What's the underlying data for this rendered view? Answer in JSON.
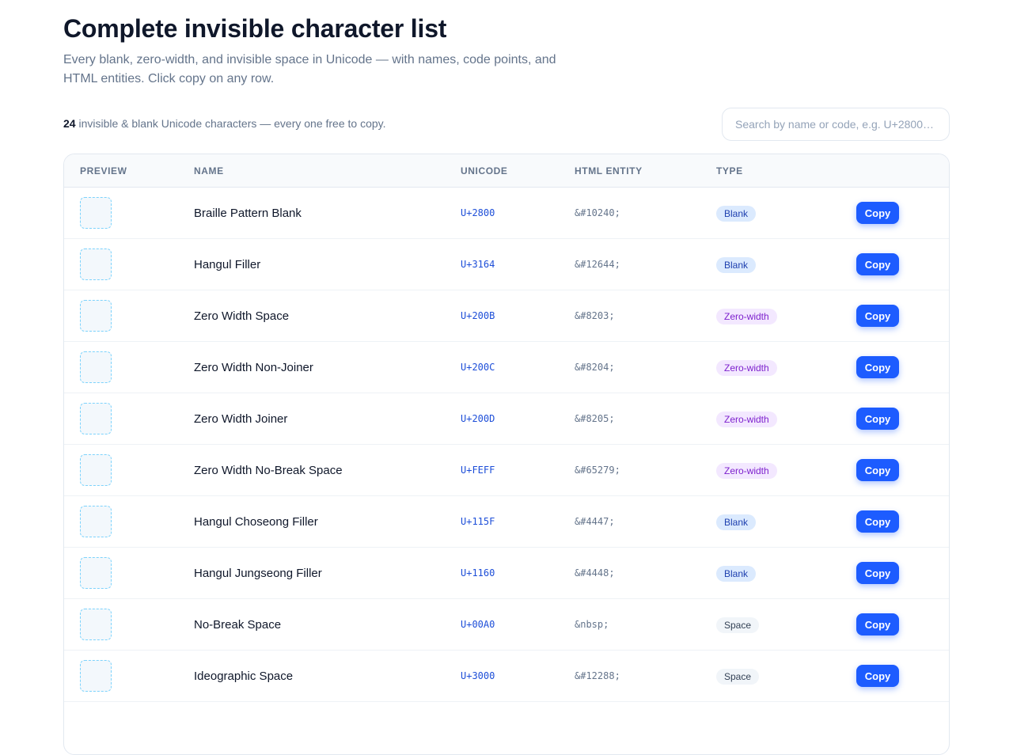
{
  "header": {
    "title": "Complete invisible character list",
    "subtitle": "Every blank, zero-width, and invisible space in Unicode — with names, code points, and HTML entities. Click copy on any row."
  },
  "summary": {
    "count": "24",
    "text": " invisible & blank Unicode characters — every one free to copy."
  },
  "search": {
    "placeholder": "Search by name or code, e.g. U+2800…",
    "value": ""
  },
  "table": {
    "columns": [
      "Preview",
      "Name",
      "Unicode",
      "HTML Entity",
      "Type"
    ],
    "copy_label": "Copy",
    "rows": [
      {
        "name": "Braille Pattern Blank",
        "code": "U+2800",
        "entity": "&#10240;",
        "type": "Blank",
        "type_class": "blank"
      },
      {
        "name": "Hangul Filler",
        "code": "U+3164",
        "entity": "&#12644;",
        "type": "Blank",
        "type_class": "blank"
      },
      {
        "name": "Zero Width Space",
        "code": "U+200B",
        "entity": "&#8203;",
        "type": "Zero-width",
        "type_class": "zw"
      },
      {
        "name": "Zero Width Non-Joiner",
        "code": "U+200C",
        "entity": "&#8204;",
        "type": "Zero-width",
        "type_class": "zw"
      },
      {
        "name": "Zero Width Joiner",
        "code": "U+200D",
        "entity": "&#8205;",
        "type": "Zero-width",
        "type_class": "zw"
      },
      {
        "name": "Zero Width No-Break Space",
        "code": "U+FEFF",
        "entity": "&#65279;",
        "type": "Zero-width",
        "type_class": "zw"
      },
      {
        "name": "Hangul Choseong Filler",
        "code": "U+115F",
        "entity": "&#4447;",
        "type": "Blank",
        "type_class": "blank"
      },
      {
        "name": "Hangul Jungseong Filler",
        "code": "U+1160",
        "entity": "&#4448;",
        "type": "Blank",
        "type_class": "blank"
      },
      {
        "name": "No-Break Space",
        "code": "U+00A0",
        "entity": "&nbsp;",
        "type": "Space",
        "type_class": "space"
      },
      {
        "name": "Ideographic Space",
        "code": "U+3000",
        "entity": "&#12288;",
        "type": "Space",
        "type_class": "space"
      }
    ]
  },
  "colors": {
    "accent": "#1d5cff",
    "blank_badge": "#dbeafe",
    "zero_width_badge": "#f3e8ff",
    "space_badge": "#f1f5f9"
  }
}
